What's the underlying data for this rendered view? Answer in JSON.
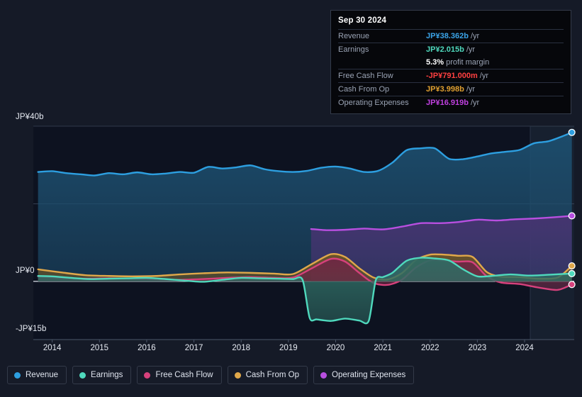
{
  "tooltip": {
    "date": "Sep 30 2024",
    "rows": [
      {
        "key": "Revenue",
        "value": "JP¥38.362b",
        "unit": "/yr",
        "color": "#3ba4e8"
      },
      {
        "key": "Earnings",
        "value": "JP¥2.015b",
        "unit": "/yr",
        "color": "#4fd9bd"
      },
      {
        "key": "",
        "value": "5.3%",
        "unit": "profit margin",
        "color": "#ffffff"
      },
      {
        "key": "Free Cash Flow",
        "value": "-JP¥791.000m",
        "unit": "/yr",
        "color": "#ff4040"
      },
      {
        "key": "Cash From Op",
        "value": "JP¥3.998b",
        "unit": "/yr",
        "color": "#e0a030"
      },
      {
        "key": "Operating Expenses",
        "value": "JP¥16.919b",
        "unit": "/yr",
        "color": "#c040e0"
      }
    ]
  },
  "legend": {
    "items": [
      {
        "label": "Revenue",
        "color": "#2d9fe0"
      },
      {
        "label": "Earnings",
        "color": "#4fd9bd"
      },
      {
        "label": "Free Cash Flow",
        "color": "#d6417c"
      },
      {
        "label": "Cash From Op",
        "color": "#e0a84a"
      },
      {
        "label": "Operating Expenses",
        "color": "#b84fe0"
      }
    ]
  },
  "chart_data": {
    "type": "area",
    "title": "",
    "xlabel": "",
    "ylabel": "",
    "currency": "JP¥",
    "ylim": [
      -15,
      40
    ],
    "yticks": [
      40,
      0,
      -15
    ],
    "ytick_labels": [
      "JP¥40b",
      "JP¥0",
      "-JP¥15b"
    ],
    "gridlines": [
      40,
      20,
      0
    ],
    "xlim": [
      2013.6,
      2025.05
    ],
    "xticks": [
      2014,
      2015,
      2016,
      2017,
      2018,
      2019,
      2020,
      2021,
      2022,
      2023,
      2024
    ],
    "xtick_labels": [
      "2014",
      "2015",
      "2016",
      "2017",
      "2018",
      "2019",
      "2020",
      "2021",
      "2022",
      "2023",
      "2024"
    ],
    "forecast_start": 2024.12,
    "legend_position": "bottom",
    "series": [
      {
        "name": "Revenue",
        "color": "#2d9fe0",
        "fill": "#1d4e6e",
        "x": [
          2013.7,
          2014.0,
          2014.3,
          2014.6,
          2014.9,
          2015.2,
          2015.5,
          2015.8,
          2016.1,
          2016.4,
          2016.7,
          2017.0,
          2017.3,
          2017.6,
          2017.9,
          2018.2,
          2018.5,
          2018.8,
          2019.1,
          2019.4,
          2019.7,
          2020.0,
          2020.3,
          2020.6,
          2020.9,
          2021.2,
          2021.5,
          2021.8,
          2022.1,
          2022.4,
          2022.7,
          2023.0,
          2023.3,
          2023.6,
          2023.9,
          2024.2,
          2024.5,
          2024.8,
          2025.0
        ],
        "y": [
          28.2,
          28.4,
          27.9,
          27.6,
          27.3,
          27.9,
          27.6,
          28.1,
          27.6,
          27.8,
          28.2,
          28.0,
          29.5,
          29.1,
          29.4,
          29.9,
          28.9,
          28.4,
          28.2,
          28.5,
          29.3,
          29.6,
          29.1,
          28.2,
          28.5,
          30.6,
          33.8,
          34.3,
          34.3,
          31.6,
          31.5,
          32.2,
          33.0,
          33.4,
          33.9,
          35.6,
          36.1,
          37.4,
          38.4
        ]
      },
      {
        "name": "Earnings",
        "color": "#4fd9bd",
        "fill": "#2f6b63",
        "x": [
          2013.7,
          2014.0,
          2014.4,
          2014.8,
          2015.2,
          2015.6,
          2016.0,
          2016.4,
          2016.8,
          2017.2,
          2017.6,
          2018.0,
          2018.4,
          2018.8,
          2019.1,
          2019.3,
          2019.45,
          2019.6,
          2019.9,
          2020.2,
          2020.5,
          2020.7,
          2020.85,
          2021.0,
          2021.2,
          2021.5,
          2021.8,
          2022.1,
          2022.4,
          2022.7,
          2023.0,
          2023.3,
          2023.7,
          2024.1,
          2024.5,
          2024.8,
          2025.0
        ],
        "y": [
          1.4,
          1.3,
          0.9,
          0.6,
          0.7,
          0.8,
          0.9,
          0.6,
          0.2,
          -0.1,
          0.4,
          0.9,
          0.8,
          0.7,
          0.6,
          0.4,
          -9.4,
          -9.8,
          -10.2,
          -9.6,
          -10.1,
          -10.2,
          0.3,
          1.1,
          2.2,
          5.3,
          6.1,
          5.9,
          5.4,
          3.1,
          1.3,
          1.4,
          1.8,
          1.5,
          1.7,
          1.9,
          2.0
        ]
      },
      {
        "name": "Free Cash Flow",
        "color": "#d6417c",
        "fill": "#6e2744",
        "x": [
          2013.7,
          2014.2,
          2014.7,
          2015.2,
          2015.7,
          2016.2,
          2016.7,
          2017.2,
          2017.7,
          2018.2,
          2018.7,
          2019.1,
          2019.5,
          2019.9,
          2020.2,
          2020.5,
          2020.8,
          2021.1,
          2021.4,
          2021.7,
          2022.0,
          2022.3,
          2022.6,
          2022.9,
          2023.2,
          2023.5,
          2023.9,
          2024.3,
          2024.7,
          2025.0
        ],
        "y": [
          1.3,
          0.9,
          0.7,
          0.8,
          0.7,
          0.5,
          0.4,
          0.6,
          0.9,
          1.1,
          0.9,
          1.0,
          3.4,
          5.8,
          5.1,
          2.2,
          -0.4,
          -0.9,
          0.4,
          3.6,
          5.4,
          5.3,
          5.1,
          4.9,
          1.3,
          -0.3,
          -0.7,
          -1.6,
          -2.2,
          -0.8
        ]
      },
      {
        "name": "Cash From Op",
        "color": "#e0a84a",
        "fill": "#6b5424",
        "x": [
          2013.7,
          2014.2,
          2014.7,
          2015.2,
          2015.7,
          2016.2,
          2016.7,
          2017.2,
          2017.7,
          2018.2,
          2018.7,
          2019.1,
          2019.5,
          2019.9,
          2020.2,
          2020.5,
          2020.8,
          2021.1,
          2021.4,
          2021.7,
          2022.0,
          2022.3,
          2022.6,
          2022.9,
          2023.2,
          2023.5,
          2023.9,
          2024.3,
          2024.7,
          2025.0
        ],
        "y": [
          3.1,
          2.3,
          1.6,
          1.4,
          1.3,
          1.4,
          1.8,
          2.1,
          2.3,
          2.2,
          2.0,
          1.9,
          4.5,
          7.0,
          6.3,
          3.4,
          1.0,
          0.5,
          2.1,
          5.5,
          6.9,
          6.9,
          6.6,
          6.3,
          2.4,
          1.2,
          1.1,
          0.7,
          1.0,
          4.0
        ]
      },
      {
        "name": "Operating Expenses",
        "color": "#b84fe0",
        "fill": "#473471",
        "x": [
          2019.48,
          2019.8,
          2020.2,
          2020.6,
          2021.0,
          2021.4,
          2021.8,
          2022.2,
          2022.6,
          2023.0,
          2023.4,
          2023.8,
          2024.2,
          2024.6,
          2025.0
        ],
        "y": [
          13.5,
          13.2,
          13.3,
          13.6,
          13.4,
          14.1,
          15.0,
          15.0,
          15.3,
          15.9,
          15.7,
          16.0,
          16.2,
          16.5,
          16.9
        ]
      }
    ]
  }
}
